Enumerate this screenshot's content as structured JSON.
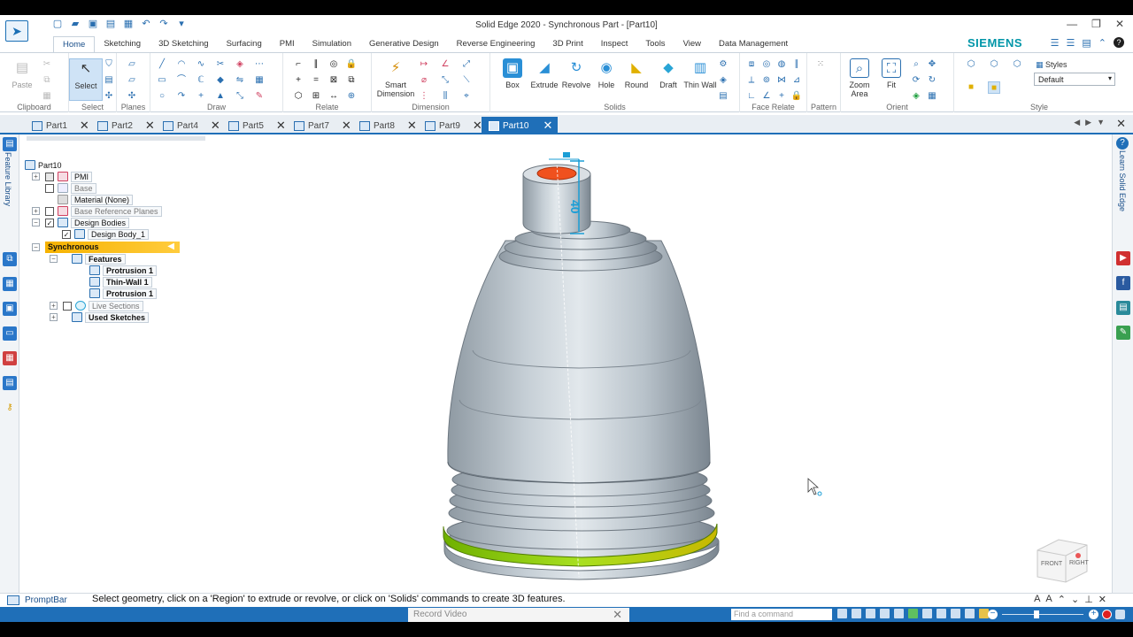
{
  "window": {
    "title": "Solid Edge 2020 - Synchronous Part - [Part10]"
  },
  "ribbon": {
    "tabs": [
      "Home",
      "Sketching",
      "3D Sketching",
      "Surfacing",
      "PMI",
      "Simulation",
      "Generative Design",
      "Reverse Engineering",
      "3D Print",
      "Inspect",
      "Tools",
      "View",
      "Data Management"
    ],
    "active_tab": "Home",
    "brand": "SIEMENS",
    "groups": {
      "clipboard": "Clipboard",
      "select": "Select",
      "planes": "Planes",
      "draw": "Draw",
      "relate": "Relate",
      "dimension": "Dimension",
      "solids": "Solids",
      "face_relate": "Face Relate",
      "pattern": "Pattern",
      "orient": "Orient",
      "style": "Style"
    },
    "buttons": {
      "paste": "Paste",
      "select": "Select",
      "smart_dimension": "Smart Dimension",
      "box": "Box",
      "extrude": "Extrude",
      "revolve": "Revolve",
      "hole": "Hole",
      "round": "Round",
      "draft": "Draft",
      "thin_wall": "Thin Wall",
      "zoom_area": "Zoom Area",
      "fit": "Fit"
    },
    "styles_label": "Styles",
    "styles_value": "Default"
  },
  "doc_tabs": [
    {
      "label": "Part1"
    },
    {
      "label": "Part2"
    },
    {
      "label": "Part4"
    },
    {
      "label": "Part5"
    },
    {
      "label": "Part7"
    },
    {
      "label": "Part8"
    },
    {
      "label": "Part9"
    },
    {
      "label": "Part10",
      "active": true
    }
  ],
  "left_rail": {
    "label": "Feature Library"
  },
  "right_rail": {
    "label": "Learn Solid Edge"
  },
  "pathfinder": {
    "root": "Part10",
    "pmi": "PMI",
    "base": "Base",
    "material": "Material (None)",
    "base_ref_planes": "Base Reference Planes",
    "design_bodies": "Design Bodies",
    "design_body": "Design Body_1",
    "synchronous": "Synchronous",
    "features": "Features",
    "feature_items": [
      "Protrusion 1",
      "Thin-Wall 1",
      "Protrusion 1"
    ],
    "live_sections": "Live Sections",
    "used_sketches": "Used Sketches"
  },
  "viewport": {
    "dimension_value": "40",
    "view_cube_front": "FRONT",
    "view_cube_right": "RIGHT"
  },
  "prompt_bar": {
    "label": "PromptBar",
    "text": "Select geometry, click on a 'Region' to extrude or revolve, or click on 'Solids' commands to create 3D features."
  },
  "status_bar": {
    "record_video": "Record Video",
    "find_command_placeholder": "Find a command"
  },
  "colors": {
    "accent": "#1f6fb8",
    "sync_highlight": "#f6b200",
    "selected_face_green": "#8fd400",
    "hole_orange": "#f0511e"
  }
}
